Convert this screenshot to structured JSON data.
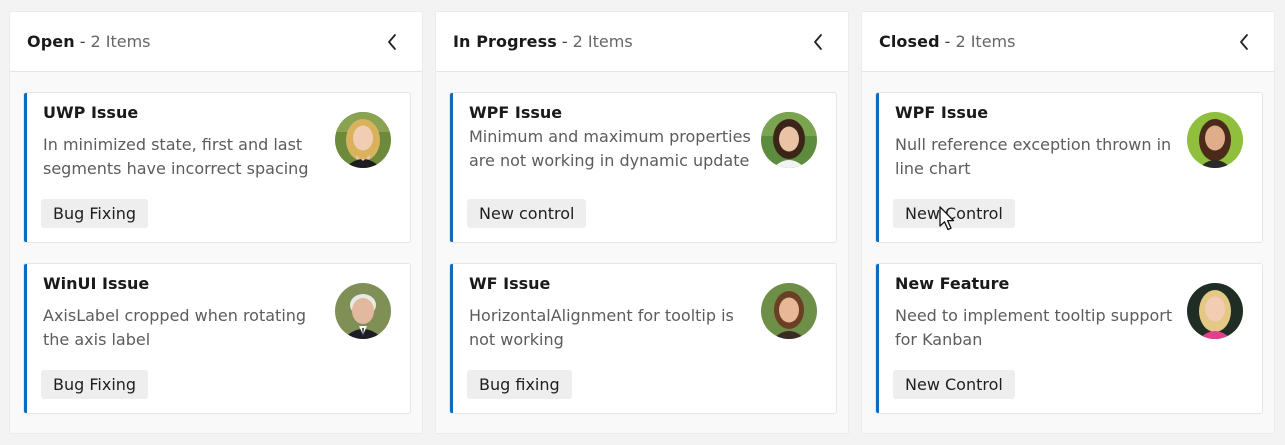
{
  "board": {
    "columns": [
      {
        "name": "Open",
        "separator": "-",
        "count": "2 Items",
        "cards": [
          {
            "title": "UWP Issue",
            "description": "In minimized state, first and last segments have incorrect spacing",
            "tag": "Bug Fixing",
            "avatar": "avatar-woman-blonde"
          },
          {
            "title": "WinUI Issue",
            "description": "AxisLabel cropped when rotating the axis label",
            "tag": "Bug Fixing",
            "avatar": "avatar-older-man"
          }
        ]
      },
      {
        "name": "In Progress",
        "separator": "-",
        "count": "2 Items",
        "cards": [
          {
            "title": "WPF Issue",
            "description": "Minimum and maximum properties are not working in dynamic update",
            "tag": "New control",
            "avatar": "avatar-woman-dark-hair"
          },
          {
            "title": "WF Issue",
            "description": "HorizontalAlignment for tooltip is not working",
            "tag": "Bug fixing",
            "avatar": "avatar-woman-auburn"
          }
        ]
      },
      {
        "name": "Closed",
        "separator": "-",
        "count": "2 Items",
        "cards": [
          {
            "title": "WPF Issue",
            "description": "Null reference exception thrown in line chart",
            "tag": "New Control",
            "avatar": "avatar-woman-brunette"
          },
          {
            "title": "New Feature",
            "description": "Need to implement tooltip support for Kanban",
            "tag": "New Control",
            "avatar": "avatar-woman-blonde-pink"
          }
        ]
      }
    ]
  },
  "icons": {
    "collapse": "chevron-left-icon",
    "cursor": "mouse-pointer-icon"
  },
  "colors": {
    "accent": "#0f6cbd",
    "background": "#f3f3f3",
    "card": "#ffffff",
    "tag": "#eeeeee"
  }
}
